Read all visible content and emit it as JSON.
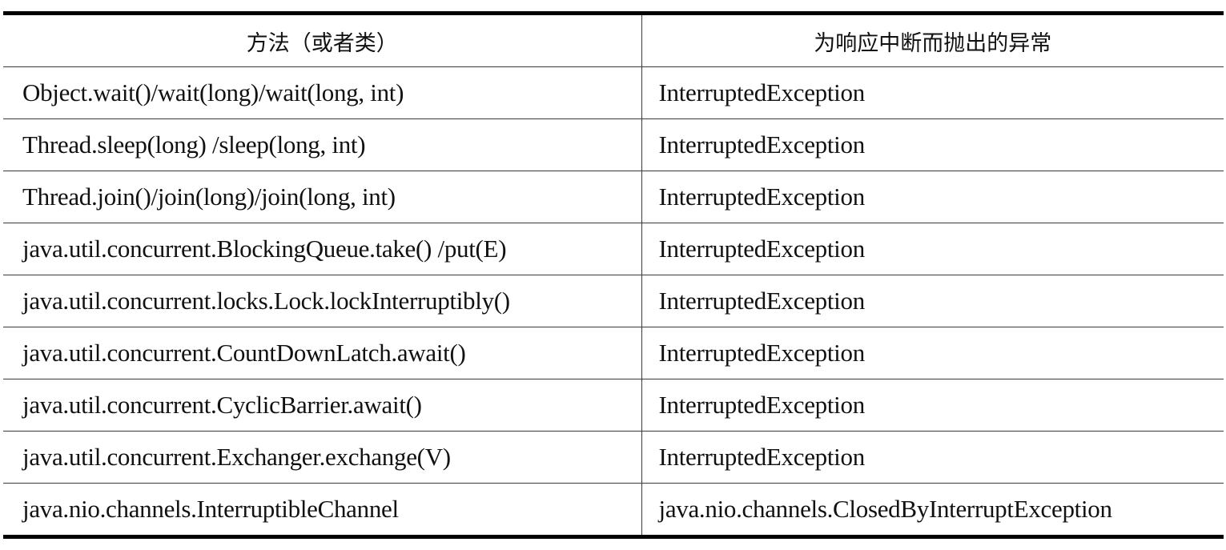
{
  "table": {
    "headers": [
      "方法（或者类）",
      "为响应中断而抛出的异常"
    ],
    "rows": [
      {
        "method": "Object.wait()/wait(long)/wait(long, int)",
        "exception": "InterruptedException"
      },
      {
        "method": "Thread.sleep(long) /sleep(long, int)",
        "exception": "InterruptedException"
      },
      {
        "method": "Thread.join()/join(long)/join(long, int)",
        "exception": "InterruptedException"
      },
      {
        "method": "java.util.concurrent.BlockingQueue.take() /put(E)",
        "exception": "InterruptedException"
      },
      {
        "method": "java.util.concurrent.locks.Lock.lockInterruptibly()",
        "exception": "InterruptedException"
      },
      {
        "method": "java.util.concurrent.CountDownLatch.await()",
        "exception": "InterruptedException"
      },
      {
        "method": "java.util.concurrent.CyclicBarrier.await()",
        "exception": "InterruptedException"
      },
      {
        "method": "java.util.concurrent.Exchanger.exchange(V)",
        "exception": "InterruptedException"
      },
      {
        "method": "java.nio.channels.InterruptibleChannel",
        "exception": "java.nio.channels.ClosedByInterruptException"
      }
    ]
  }
}
